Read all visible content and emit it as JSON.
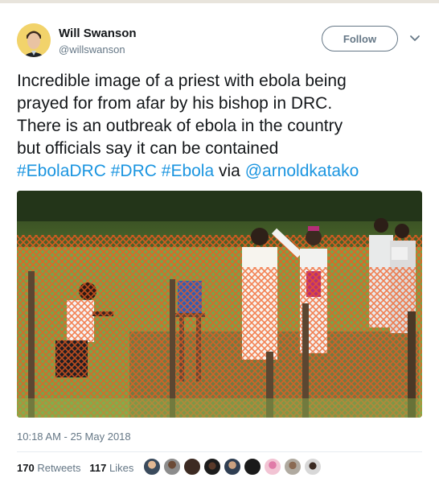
{
  "tweet": {
    "author_name": "Will Swanson",
    "author_handle": "@willswanson",
    "follow_label": "Follow",
    "text_lines": [
      "Incredible image of a priest with ebola being",
      "prayed for from afar by his bishop in DRC.",
      "There is an outbreak of ebola in the country",
      "but officials say it can be contained"
    ],
    "tags_line": {
      "tag1": "#EbolaDRC",
      "tag2": "#DRC",
      "tag3": "#Ebola",
      "via": "via",
      "mention": "@arnoldkatako"
    },
    "timestamp": "10:18 AM - 25 May 2018",
    "retweets_count": "170",
    "retweets_label": "Retweets",
    "likes_count": "117",
    "likes_label": "Likes"
  },
  "colors": {
    "link": "#1b95e0",
    "secondary_text": "#657786",
    "primary_text": "#14171a",
    "fence_orange": "#f25a1f"
  },
  "icons": {
    "menu": "chevron-down-icon"
  }
}
